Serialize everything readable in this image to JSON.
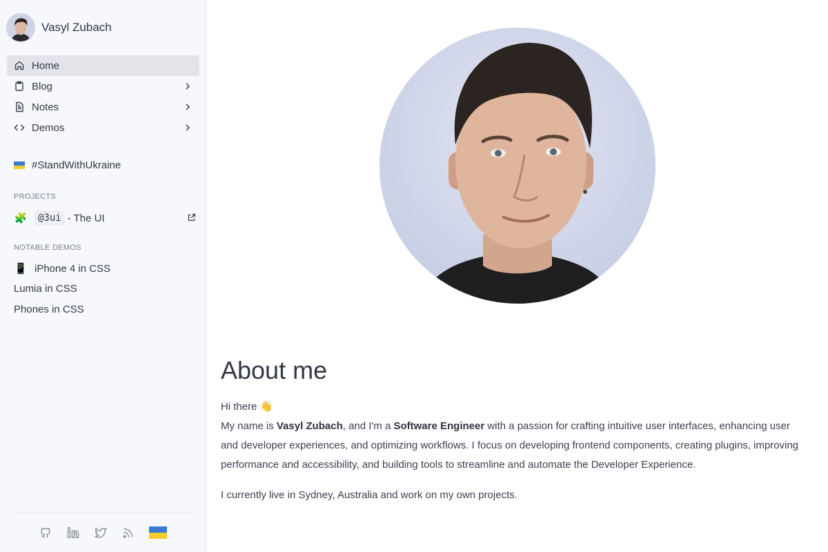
{
  "profile": {
    "name": "Vasyl Zubach"
  },
  "nav": {
    "items": [
      {
        "label": "Home",
        "icon": "home-icon",
        "active": true
      },
      {
        "label": "Blog",
        "icon": "clipboard-icon",
        "has_children": true
      },
      {
        "label": "Notes",
        "icon": "document-icon",
        "has_children": true
      },
      {
        "label": "Demos",
        "icon": "code-icon",
        "has_children": true
      }
    ]
  },
  "ukraine": {
    "label": "#StandWithUkraine",
    "colors": [
      "#3a7bd5",
      "#f5cc2e"
    ]
  },
  "projects": {
    "title": "PROJECTS",
    "items": [
      {
        "emoji": "🧩",
        "code": "@3ui",
        "text": "- The UI",
        "external": true
      }
    ]
  },
  "demos": {
    "title": "NOTABLE DEMOS",
    "items": [
      {
        "emoji": "📱",
        "label": "iPhone 4 in CSS"
      },
      {
        "label": "Lumia in CSS"
      },
      {
        "label": "Phones in CSS"
      }
    ]
  },
  "socials": [
    "github-icon",
    "linkedin-icon",
    "twitter-icon",
    "rss-icon",
    "ukraine-flag-icon"
  ],
  "about": {
    "title": "About me",
    "greeting": "Hi there 👋",
    "p1_pre": "My name is ",
    "p1_name": "Vasyl Zubach",
    "p1_mid": ", and I'm a ",
    "p1_role": "Software Engineer",
    "p1_post": " with a passion for crafting intuitive user interfaces, enhancing user and developer experiences, and optimizing workflows. I focus on developing frontend components, creating plugins, improving performance and accessibility, and building tools to streamline and automate the Developer Experience.",
    "p2": "I currently live in Sydney, Australia and work on my own projects."
  }
}
